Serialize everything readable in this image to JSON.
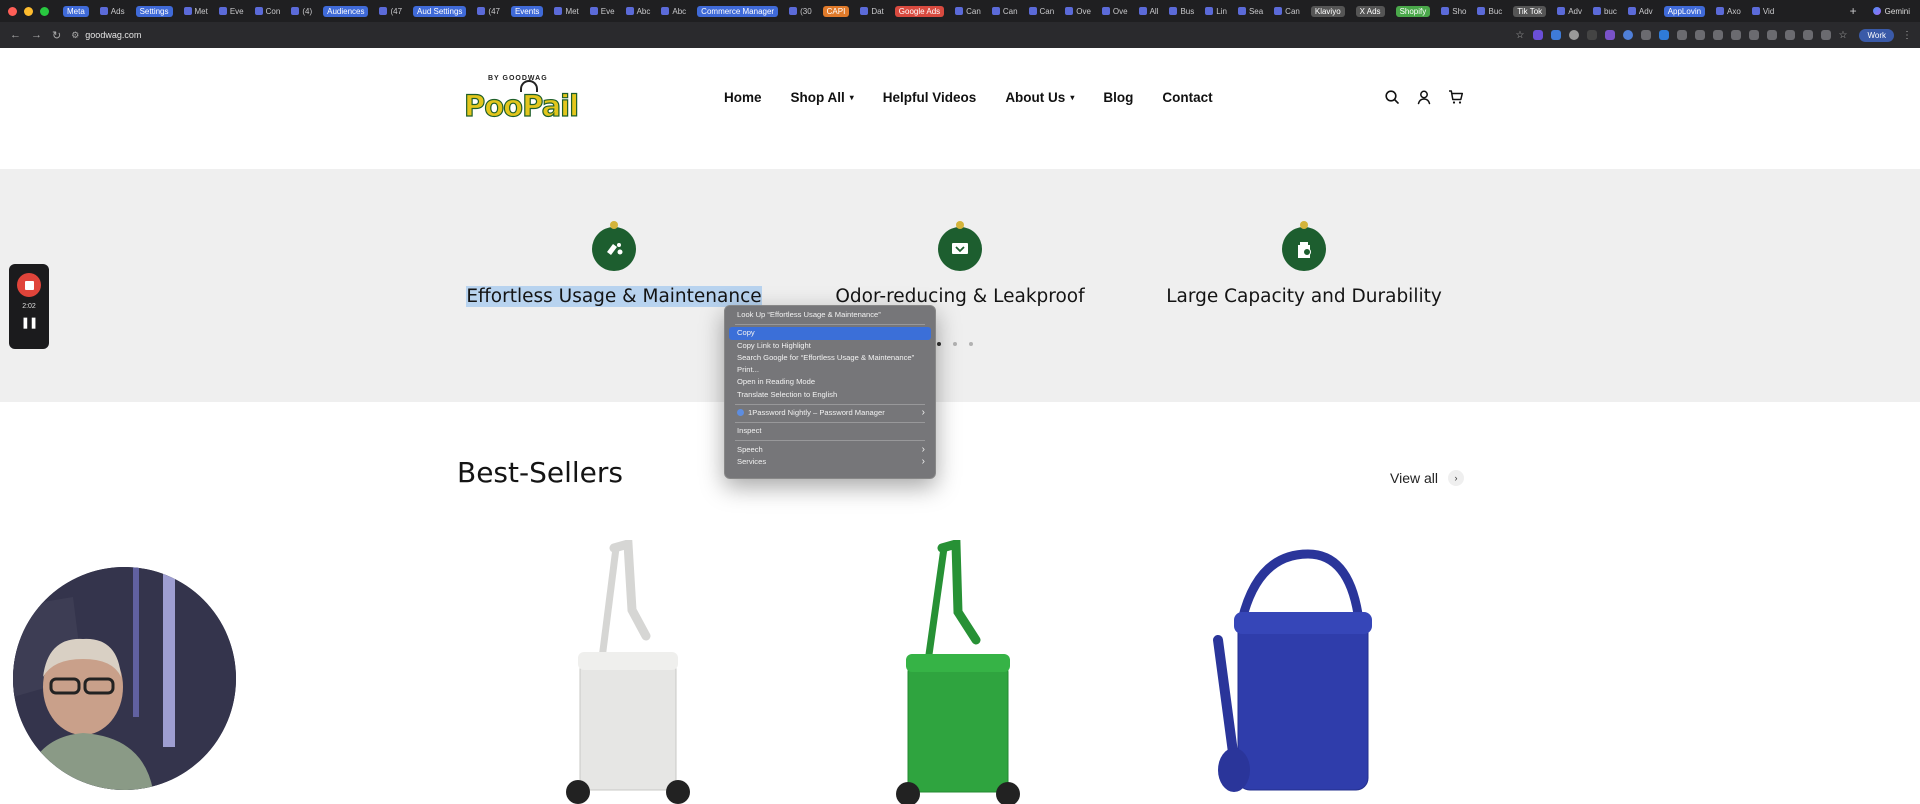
{
  "browser": {
    "tabs": [
      {
        "label": "Meta",
        "pill": true,
        "color": "#3f6ad8"
      },
      {
        "label": "Ads",
        "pill": false
      },
      {
        "label": "Settings",
        "pill": true,
        "color": "#3f6ad8"
      },
      {
        "label": "Met",
        "pill": false
      },
      {
        "label": "Eve",
        "pill": false
      },
      {
        "label": "Con",
        "pill": false
      },
      {
        "label": "(4)",
        "pill": false
      },
      {
        "label": "Audiences",
        "pill": true,
        "color": "#3f6ad8"
      },
      {
        "label": "(47",
        "pill": false
      },
      {
        "label": "Aud Settings",
        "pill": true,
        "color": "#3f6ad8"
      },
      {
        "label": "(47",
        "pill": false
      },
      {
        "label": "Events",
        "pill": true,
        "color": "#3f6ad8"
      },
      {
        "label": "Met",
        "pill": false
      },
      {
        "label": "Eve",
        "pill": false
      },
      {
        "label": "Abc",
        "pill": false
      },
      {
        "label": "Abc",
        "pill": false
      },
      {
        "label": "Commerce Manager",
        "pill": true,
        "color": "#3f6ad8"
      },
      {
        "label": "(30",
        "pill": false
      },
      {
        "label": "CAPI",
        "pill": true,
        "color": "#e07a2a"
      },
      {
        "label": "Dat",
        "pill": false
      },
      {
        "label": "Google Ads",
        "pill": true,
        "color": "#d84a3f"
      },
      {
        "label": "Can",
        "pill": false
      },
      {
        "label": "Can",
        "pill": false
      },
      {
        "label": "Can",
        "pill": false
      },
      {
        "label": "Ove",
        "pill": false
      },
      {
        "label": "Ove",
        "pill": false
      },
      {
        "label": "All",
        "pill": false
      },
      {
        "label": "Bus",
        "pill": false
      },
      {
        "label": "Lin",
        "pill": false
      },
      {
        "label": "Sea",
        "pill": false
      },
      {
        "label": "Can",
        "pill": false
      },
      {
        "label": "Klaviyo",
        "pill": true,
        "color": "#555"
      },
      {
        "label": "X Ads",
        "pill": true,
        "color": "#555"
      },
      {
        "label": "Shopify",
        "pill": true,
        "color": "#4aa84a"
      },
      {
        "label": "Sho",
        "pill": false
      },
      {
        "label": "Buc",
        "pill": false
      },
      {
        "label": "Tik Tok",
        "pill": true,
        "color": "#555"
      },
      {
        "label": "Adv",
        "pill": false
      },
      {
        "label": "buc",
        "pill": false
      },
      {
        "label": "Adv",
        "pill": false
      },
      {
        "label": "AppLovin",
        "pill": true,
        "color": "#3f6ad8"
      },
      {
        "label": "Axo",
        "pill": false
      },
      {
        "label": "Vid",
        "pill": false
      }
    ],
    "new_tab": "+",
    "gemini_label": "Gemini",
    "url": "goodwag.com",
    "profile_label": "Work"
  },
  "header": {
    "logo_by": "BY GOODWAG",
    "logo_name": "PooPail",
    "nav": [
      {
        "label": "Home",
        "dropdown": false
      },
      {
        "label": "Shop All",
        "dropdown": true
      },
      {
        "label": "Helpful Videos",
        "dropdown": false
      },
      {
        "label": "About Us",
        "dropdown": true
      },
      {
        "label": "Blog",
        "dropdown": false
      },
      {
        "label": "Contact",
        "dropdown": false
      }
    ],
    "icons": [
      "search-icon",
      "account-icon",
      "cart-icon"
    ]
  },
  "features": {
    "items": [
      {
        "title": "Effortless Usage & Maintenance",
        "selected": true
      },
      {
        "title": "Odor-reducing & Leakproof",
        "selected": false
      },
      {
        "title": "Large Capacity and Durability",
        "selected": false
      }
    ],
    "active_dot": 0,
    "dot_count": 3
  },
  "context_menu": {
    "items": [
      {
        "label": "Look Up “Effortless Usage & Maintenance”",
        "type": "item"
      },
      {
        "type": "sep"
      },
      {
        "label": "Copy",
        "type": "item",
        "highlight": true
      },
      {
        "label": "Copy Link to Highlight",
        "type": "item"
      },
      {
        "label": "Search Google for “Effortless Usage & Maintenance”",
        "type": "item"
      },
      {
        "label": "Print...",
        "type": "item"
      },
      {
        "label": "Open in Reading Mode",
        "type": "item"
      },
      {
        "label": "Translate Selection to English",
        "type": "item"
      },
      {
        "type": "sep"
      },
      {
        "label": "1Password Nightly – Password Manager",
        "type": "item",
        "submenu": true,
        "icon": true
      },
      {
        "type": "sep"
      },
      {
        "label": "Inspect",
        "type": "item"
      },
      {
        "type": "sep"
      },
      {
        "label": "Speech",
        "type": "item",
        "submenu": true
      },
      {
        "label": "Services",
        "type": "item",
        "submenu": true
      }
    ]
  },
  "bestsellers": {
    "title": "Best-Sellers",
    "view_all": "View all",
    "products": [
      {
        "color": "#e6e6e4",
        "handle": "#d4d4d2"
      },
      {
        "color": "#2fa43f",
        "handle": "#279135"
      },
      {
        "color": "#2f3dab",
        "handle": "#2a359a"
      }
    ]
  },
  "recorder": {
    "time": "2:02"
  }
}
